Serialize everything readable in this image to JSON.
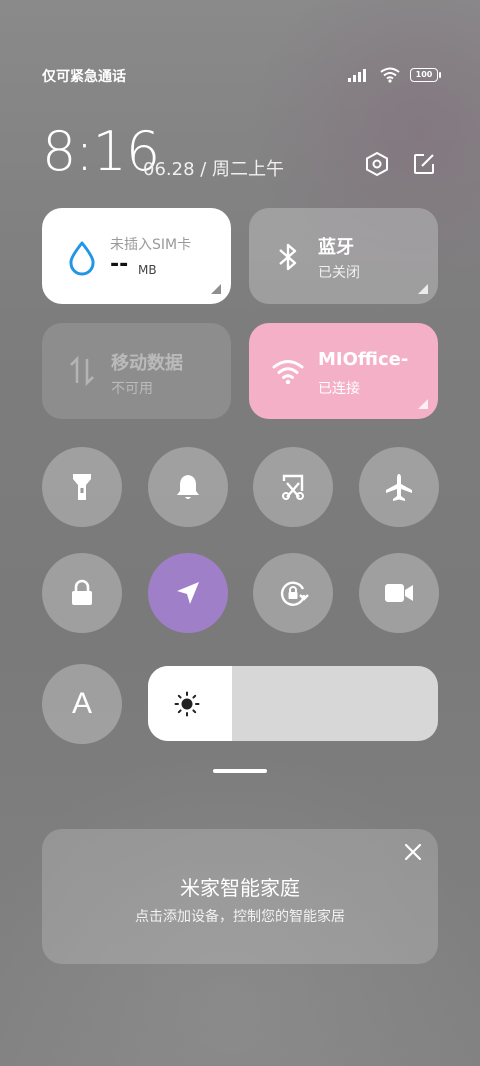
{
  "status_bar": {
    "carrier": "仅可紧急通话",
    "battery": "100",
    "icons": [
      "signal-icon",
      "wifi-icon",
      "battery-icon"
    ]
  },
  "clock": {
    "time": "8:16",
    "date": "06.28 / 周二上午"
  },
  "top_actions": [
    "settings-icon",
    "edit-icon"
  ],
  "tiles": {
    "data_usage": {
      "title": "未插入SIM卡",
      "value": "--",
      "unit": "MB",
      "icon": "drop-icon"
    },
    "bluetooth": {
      "title": "蓝牙",
      "status": "已关闭",
      "icon": "bluetooth-icon"
    },
    "mobile_data": {
      "title": "移动数据",
      "status": "不可用",
      "icon": "data-arrows-icon"
    },
    "wifi": {
      "title": "MIOffice-",
      "status": "已连接",
      "icon": "wifi-icon",
      "color": "#f4b0c6"
    }
  },
  "toggles_row1": [
    "flashlight-icon",
    "bell-icon",
    "screenshot-icon",
    "airplane-icon"
  ],
  "toggles_row2": [
    "lock-icon",
    "location-icon",
    "rotation-lock-icon",
    "video-camera-icon"
  ],
  "auto_brightness": {
    "label": "A"
  },
  "brightness": {
    "level": 0.29,
    "icon": "sun-icon"
  },
  "smart_home": {
    "title": "米家智能家庭",
    "subtitle": "点击添加设备，控制您的智能家居"
  },
  "colors": {
    "location_active": "#a07fc9",
    "wifi_active": "#f4b0c6",
    "water_blue": "#2196e8"
  }
}
